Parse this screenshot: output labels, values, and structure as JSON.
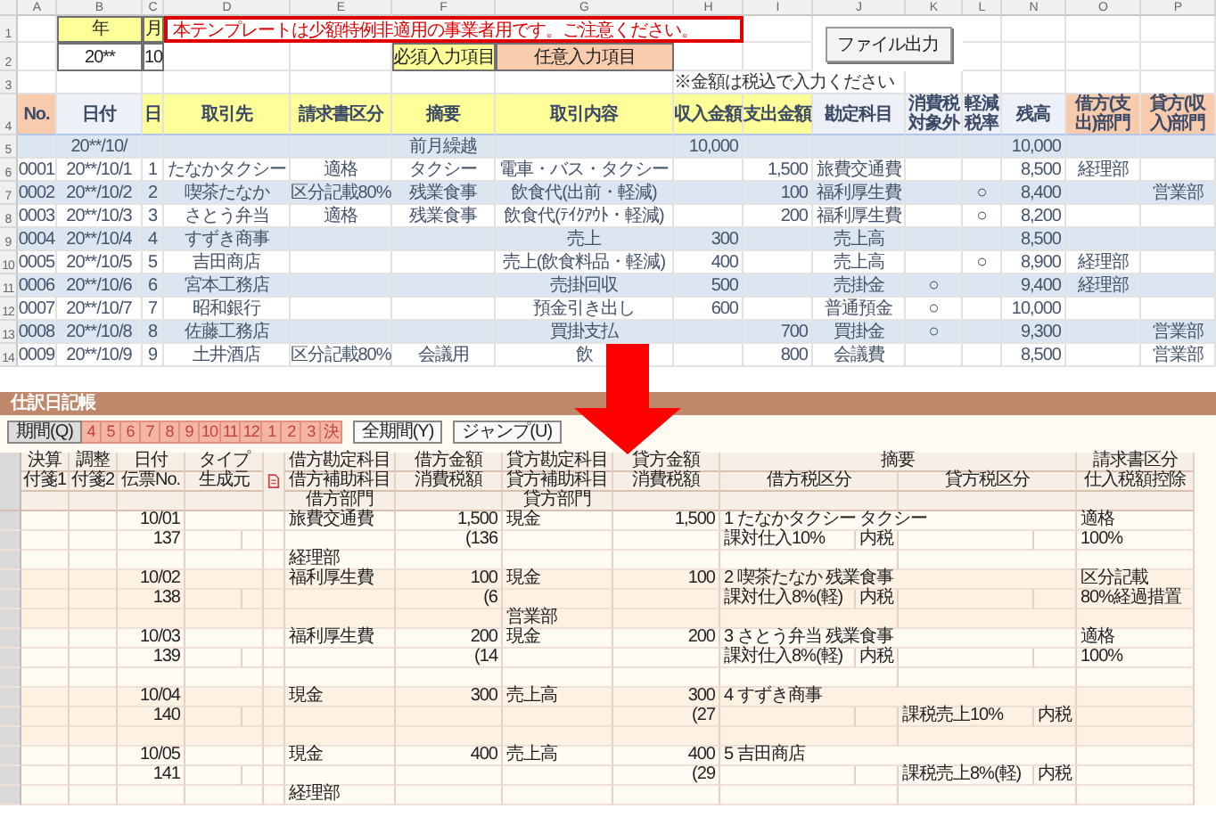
{
  "sheet": {
    "columns": [
      "A",
      "B",
      "C",
      "D",
      "E",
      "F",
      "G",
      "H",
      "I",
      "J",
      "K",
      "L",
      "N",
      "O",
      "P"
    ],
    "row_numbers": [
      "1",
      "2",
      "3",
      "4",
      "5",
      "6",
      "7",
      "8",
      "9",
      "10",
      "11",
      "12",
      "13",
      "14"
    ],
    "year_label": "年",
    "month_label": "月",
    "year": "20**",
    "month": "10",
    "notice": "本テンプレートは少額特例非適用の事業者用です。ご注意ください。",
    "required_label": "必須入力項目",
    "optional_label": "任意入力項目",
    "note": "※金額は税込で入力ください",
    "export_button": "ファイル出力",
    "headers": [
      {
        "label": "No.",
        "kind": "optional"
      },
      {
        "label": "日付",
        "kind": "auto"
      },
      {
        "label": "日",
        "kind": "required"
      },
      {
        "label": "取引先",
        "kind": "required"
      },
      {
        "label": "請求書区分",
        "kind": "required"
      },
      {
        "label": "摘要",
        "kind": "required"
      },
      {
        "label": "取引内容",
        "kind": "required"
      },
      {
        "label": "収入金額",
        "kind": "required"
      },
      {
        "label": "支出金額",
        "kind": "required"
      },
      {
        "label": "勘定科目",
        "kind": "auto"
      },
      {
        "label": "消費税対象外",
        "kind": "auto"
      },
      {
        "label": "軽減税率",
        "kind": "auto"
      },
      {
        "label": "残高",
        "kind": "auto"
      },
      {
        "label": "借方(支出)部門",
        "kind": "optional"
      },
      {
        "label": "貸方(収入)部門",
        "kind": "optional"
      }
    ],
    "carry": {
      "date": "20**/10/",
      "label": "前月繰越",
      "income": "10,000",
      "balance": "10,000"
    },
    "rows": [
      {
        "no": "0001",
        "date": "20**/10/1",
        "day": "1",
        "partner": "たなかタクシー",
        "invoice": "適格",
        "summary": "タクシー",
        "content": "電車・バス・タクシー",
        "expense": "1,500",
        "account": "旅費交通費",
        "balance": "8,500",
        "debit_dept": "経理部"
      },
      {
        "no": "0002",
        "date": "20**/10/2",
        "day": "2",
        "partner": "喫茶たなか",
        "invoice": "区分記載80%",
        "summary": "残業食事",
        "content": "飲食代(出前・軽減)",
        "expense": "100",
        "account": "福利厚生費",
        "reduced": "○",
        "balance": "8,400",
        "credit_dept": "営業部"
      },
      {
        "no": "0003",
        "date": "20**/10/3",
        "day": "3",
        "partner": "さとう弁当",
        "invoice": "適格",
        "summary": "残業食事",
        "content": "飲食代(ﾃｲｸｱｳﾄ・軽減)",
        "expense": "200",
        "account": "福利厚生費",
        "reduced": "○",
        "balance": "8,200"
      },
      {
        "no": "0004",
        "date": "20**/10/4",
        "day": "4",
        "partner": "すずき商事",
        "content": "売上",
        "income": "300",
        "account": "売上高",
        "balance": "8,500"
      },
      {
        "no": "0005",
        "date": "20**/10/5",
        "day": "5",
        "partner": "吉田商店",
        "content": "売上(飲食料品・軽減)",
        "income": "400",
        "account": "売上高",
        "reduced": "○",
        "balance": "8,900",
        "debit_dept": "経理部"
      },
      {
        "no": "0006",
        "date": "20**/10/6",
        "day": "6",
        "partner": "宮本工務店",
        "content": "売掛回収",
        "income": "500",
        "account": "売掛金",
        "exempt": "○",
        "balance": "9,400",
        "debit_dept": "経理部"
      },
      {
        "no": "0007",
        "date": "20**/10/7",
        "day": "7",
        "partner": "昭和銀行",
        "content": "預金引き出し",
        "income": "600",
        "account": "普通預金",
        "exempt": "○",
        "balance": "10,000"
      },
      {
        "no": "0008",
        "date": "20**/10/8",
        "day": "8",
        "partner": "佐藤工務店",
        "content": "買掛支払",
        "expense": "700",
        "account": "買掛金",
        "exempt": "○",
        "balance": "9,300",
        "credit_dept": "営業部"
      },
      {
        "no": "0009",
        "date": "20**/10/9",
        "day": "9",
        "partner": "土井酒店",
        "invoice": "区分記載80%",
        "summary": "会議用",
        "content": "飲",
        "expense": "800",
        "account": "会議費",
        "balance": "8,500",
        "credit_dept": "営業部"
      }
    ]
  },
  "journal": {
    "title": "仕訳日記帳",
    "period_button": "期間(Q)",
    "months": [
      "4",
      "5",
      "6",
      "7",
      "8",
      "9",
      "10",
      "11",
      "12",
      "1",
      "2",
      "3",
      "決"
    ],
    "all_button": "全期間(Y)",
    "jump_button": "ジャンプ(U)",
    "header": {
      "settle": [
        "決算",
        "付箋1"
      ],
      "adjust": [
        "調整",
        "付箋2"
      ],
      "date": [
        "日付",
        "伝票No."
      ],
      "type": [
        "タイプ",
        "生成元"
      ],
      "debit_account": [
        "借方勘定科目",
        "借方補助科目",
        "借方部門"
      ],
      "debit_amount": [
        "借方金額",
        "消費税額"
      ],
      "credit_account": [
        "貸方勘定科目",
        "貸方補助科目",
        "貸方部門"
      ],
      "credit_amount": [
        "貸方金額",
        "消費税額"
      ],
      "memo": "摘要",
      "debit_tax_class": "借方税区分",
      "credit_tax_class": "貸方税区分",
      "invoice": [
        "請求書区分",
        "仕入税額控除"
      ]
    },
    "entries": [
      {
        "date": "10/01",
        "voucher": "137",
        "debit_account": "旅費交通費",
        "debit_amount": "1,500",
        "debit_tax": "(136",
        "debit_dept": "経理部",
        "credit_account": "現金",
        "credit_amount": "1,500",
        "memo": "1 たなかタクシー タクシー",
        "invoice": "適格",
        "debit_tax_class": "課対仕入10%",
        "debit_tax_mode": "内税",
        "deduction": "100%"
      },
      {
        "date": "10/02",
        "voucher": "138",
        "debit_account": "福利厚生費",
        "debit_amount": "100",
        "debit_tax": "(6",
        "credit_account": "現金",
        "credit_amount": "100",
        "credit_dept": "営業部",
        "memo": "2 喫茶たなか 残業食事",
        "invoice": "区分記載",
        "debit_tax_class": "課対仕入8%(軽)",
        "debit_tax_mode": "内税",
        "deduction": "80%経過措置"
      },
      {
        "date": "10/03",
        "voucher": "139",
        "debit_account": "福利厚生費",
        "debit_amount": "200",
        "debit_tax": "(14",
        "credit_account": "現金",
        "credit_amount": "200",
        "memo": "3 さとう弁当 残業食事",
        "invoice": "適格",
        "debit_tax_class": "課対仕入8%(軽)",
        "debit_tax_mode": "内税",
        "deduction": "100%"
      },
      {
        "date": "10/04",
        "voucher": "140",
        "debit_account": "現金",
        "debit_amount": "300",
        "credit_account": "売上高",
        "credit_amount": "300",
        "credit_tax": "(27",
        "memo": "4 すずき商事",
        "credit_tax_class": "課税売上10%",
        "credit_tax_mode": "内税"
      },
      {
        "date": "10/05",
        "voucher": "141",
        "debit_account": "現金",
        "debit_amount": "400",
        "debit_dept": "経理部",
        "credit_account": "売上高",
        "credit_amount": "400",
        "credit_tax": "(29",
        "memo": "5 吉田商店",
        "credit_tax_class": "課税売上8%(軽)",
        "credit_tax_mode": "内税"
      }
    ]
  }
}
